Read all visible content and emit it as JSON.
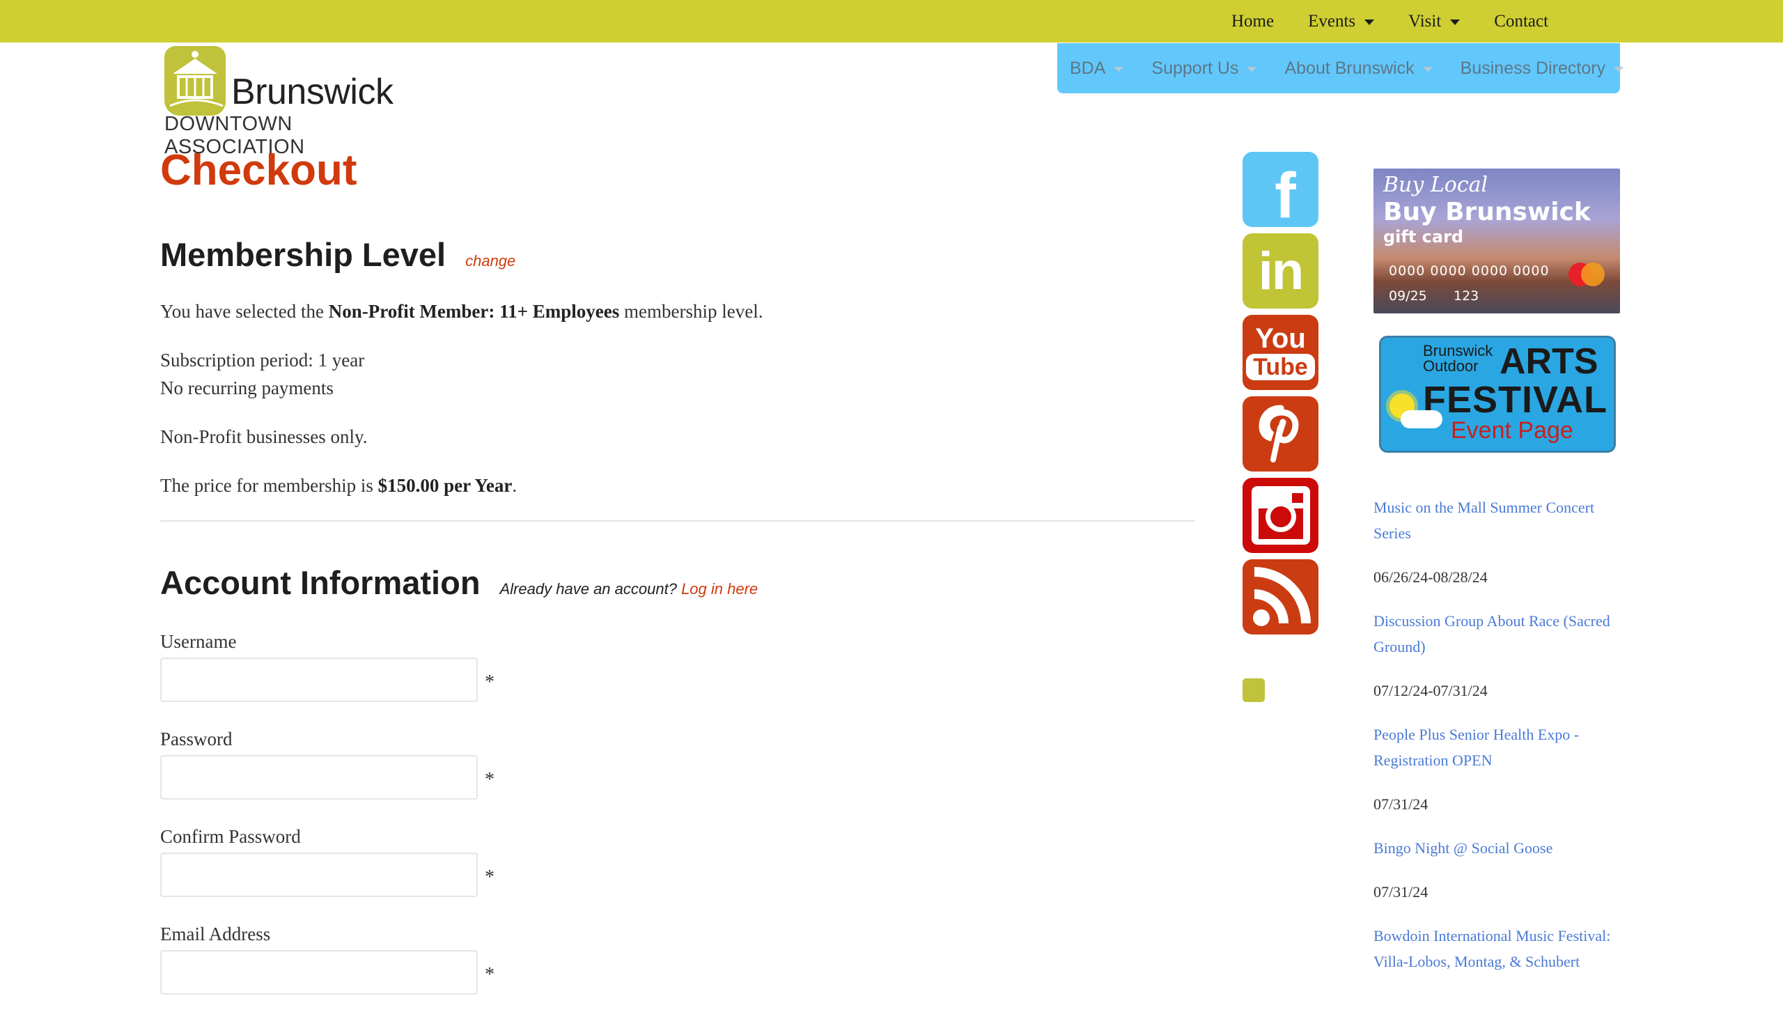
{
  "top_nav": {
    "items": [
      {
        "label": "Home",
        "dropdown": false
      },
      {
        "label": "Events",
        "dropdown": true
      },
      {
        "label": "Visit",
        "dropdown": true
      },
      {
        "label": "Contact",
        "dropdown": false
      }
    ]
  },
  "logo": {
    "word": "Brunswick",
    "subtitle": "DOWNTOWN ASSOCIATION"
  },
  "secondary_nav": {
    "items": [
      {
        "label": "BDA",
        "dropdown": true
      },
      {
        "label": "Support Us",
        "dropdown": true
      },
      {
        "label": "About Brunswick",
        "dropdown": true
      },
      {
        "label": "Business Directory",
        "dropdown": true
      }
    ]
  },
  "main": {
    "page_title": "Checkout",
    "membership": {
      "heading": "Membership Level",
      "change_link": "change",
      "selected_prefix": "You have selected the ",
      "selected_level": "Non-Profit Member: 11+ Employees",
      "selected_suffix": " membership level.",
      "subscription_period": "Subscription period: 1 year",
      "recurring": "No recurring payments",
      "description": "Non-Profit businesses only.",
      "price_prefix": "The price for membership is ",
      "price": "$150.00 per Year",
      "price_suffix": "."
    },
    "account": {
      "heading": "Account Information",
      "login_prompt": "Already have an account? ",
      "login_link": "Log in here",
      "fields": [
        {
          "label": "Username",
          "value": "",
          "required_mark": "*"
        },
        {
          "label": "Password",
          "value": "",
          "required_mark": "*"
        },
        {
          "label": "Confirm Password",
          "value": "",
          "required_mark": "*"
        },
        {
          "label": "Email Address",
          "value": "",
          "required_mark": "*"
        }
      ]
    }
  },
  "social": {
    "items": [
      {
        "name": "facebook",
        "glyph": "f"
      },
      {
        "name": "linkedin",
        "glyph": "in"
      },
      {
        "name": "youtube",
        "glyph_top": "You",
        "glyph_bottom": "Tube"
      },
      {
        "name": "pinterest",
        "glyph": "P"
      },
      {
        "name": "instagram",
        "glyph": ""
      },
      {
        "name": "rss",
        "glyph": ""
      }
    ]
  },
  "sidebar": {
    "gift_card": {
      "line1": "Buy Local",
      "line2": "Buy Brunswick",
      "line3": "gift card",
      "number": "0000 0000 0000 0000",
      "expiry": "09/25",
      "cvc": "123"
    },
    "arts_festival": {
      "small": "Brunswick Outdoor",
      "arts": "ARTS",
      "festival": "FESTIVAL",
      "event_page": "Event Page"
    },
    "events": [
      {
        "title": "Music on the Mall Summer Concert Series",
        "date": "06/26/24-08/28/24"
      },
      {
        "title": "Discussion Group About Race (Sacred Ground)",
        "date": "07/12/24-07/31/24"
      },
      {
        "title": "People Plus Senior Health Expo - Registration OPEN",
        "date": "07/31/24"
      },
      {
        "title": "Bingo Night @ Social Goose",
        "date": "07/31/24"
      },
      {
        "title": "Bowdoin International Music Festival: Villa-Lobos, Montag, & Schubert",
        "date": ""
      }
    ]
  },
  "colors": {
    "top_bar": "#cfcf33",
    "secondary_nav": "#62c8fc",
    "accent_red": "#d03a0c",
    "event_link": "#4a7ad6"
  }
}
